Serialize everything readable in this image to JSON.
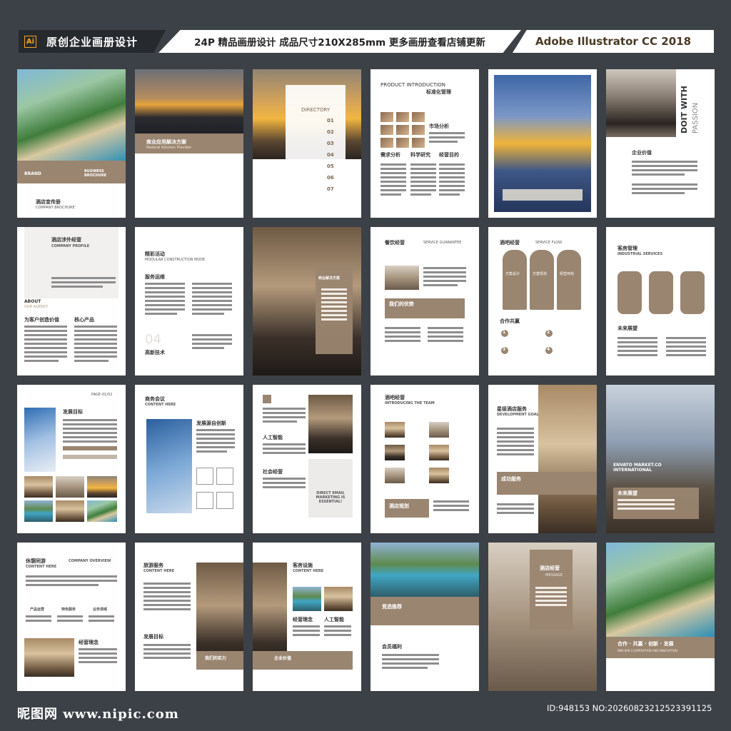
{
  "header": {
    "app_icon": "Ai",
    "left_title": "原创企业画册设计",
    "middle_title": "24P 精品画册设计  成品尺寸210X285mm  更多画册查看店铺更新",
    "right_title": "Adobe Illustrator CC 2018"
  },
  "pages": {
    "p1": {
      "title": "酒店宣传册",
      "subtitle": "COMPANY BROCHURE",
      "brand": "BRAND",
      "tag": "BUSINESS BROCHURE"
    },
    "p2": {
      "title": "商业应用解决方案",
      "subtitle": "Medical Solution Provider"
    },
    "p3": {
      "title": "DIRECTORY",
      "items": [
        "01",
        "02",
        "03",
        "04",
        "05",
        "06",
        "07"
      ]
    },
    "p4": {
      "title": "PRODUCT INTRODUCTION",
      "title_cn": "标准化管理",
      "s1": "市场分析",
      "s2": "需求分析",
      "s3": "科学研究",
      "s4": "经营目的"
    },
    "p6": {
      "title": "DOIT WITH",
      "sub": "PASSION",
      "label": "企业价值"
    },
    "p7": {
      "title": "酒店涉外经营",
      "sub": "COMPANY PROFILE",
      "about": "ABOUT",
      "about2": "OUR AGENCY",
      "c1": "为客户创造价值",
      "c2": "核心产品"
    },
    "p8": {
      "title": "精彩活动",
      "sub": "MODULAR CONSTRUCTION MODE",
      "s1": "服务运维",
      "num": "04",
      "s2": "高新技术"
    },
    "p9": {
      "title": "商业解决方案"
    },
    "p10": {
      "title": "餐饮经营",
      "sub": "SERVICE GUARANTEE",
      "band": "我们的优势"
    },
    "p11": {
      "title": "酒吧经营",
      "sub": "SERVICE FLOW",
      "i1": "方案设计",
      "i2": "方案规划",
      "i3": "经营目标",
      "s1": "合作共赢",
      "n1": "1",
      "n2": "2",
      "n3": "3",
      "n4": "4"
    },
    "p12": {
      "title": "客房管理",
      "sub": "INDUSTRIAL SERVICES",
      "s1": "未来展望"
    },
    "p13": {
      "head": "PAGE-01/02",
      "title": "发展目标"
    },
    "p14": {
      "title": "商务会议",
      "sub": "CONTENT HERE",
      "s1": "发展源自创新"
    },
    "p15": {
      "s1": "人工智能",
      "s2": "社会经营",
      "email": "DIRECT EMAIL MARKETING IS ESSENTIAL!"
    },
    "p16": {
      "title": "酒吧经营",
      "sub": "INTRODUCING THE TEAM",
      "band": "酒店规划"
    },
    "p17": {
      "title": "星级酒店服务",
      "sub": "DEVELOPMENT GOAL",
      "band": "成功服务"
    },
    "p18": {
      "title": "ENVATO MARKET.CO INTERNATIONAL",
      "band": "未来展望"
    },
    "p19": {
      "title": "休憩同游",
      "sub": "CONTENT HERE",
      "title2": "COMPANY OVERVIEW",
      "b1": "产品运营",
      "b2": "特色服务",
      "b3": "业务领域",
      "s1": "经营理念"
    },
    "p20": {
      "title": "旅游服务",
      "sub": "CONTENT HERE",
      "s1": "发展目标",
      "band": "我们的实力"
    },
    "p21": {
      "title": "客房设施",
      "sub": "CONTENT HERE",
      "s1": "经营理念",
      "s2": "人工智能",
      "band": "企业价值"
    },
    "p22": {
      "band": "竞选推荐",
      "s1": "会员福利"
    },
    "p23": {
      "title": "酒店经营",
      "sub": "MESSAGE"
    },
    "p24": {
      "band": "合作 · 共赢 · 创新 · 发展",
      "sub": "WIN-WIN COOPERATION AND INNOVATION"
    }
  },
  "footer": {
    "site": "昵图网 www.nipic.com",
    "id_text": "ID:948153 NO:20260823212523391125"
  }
}
